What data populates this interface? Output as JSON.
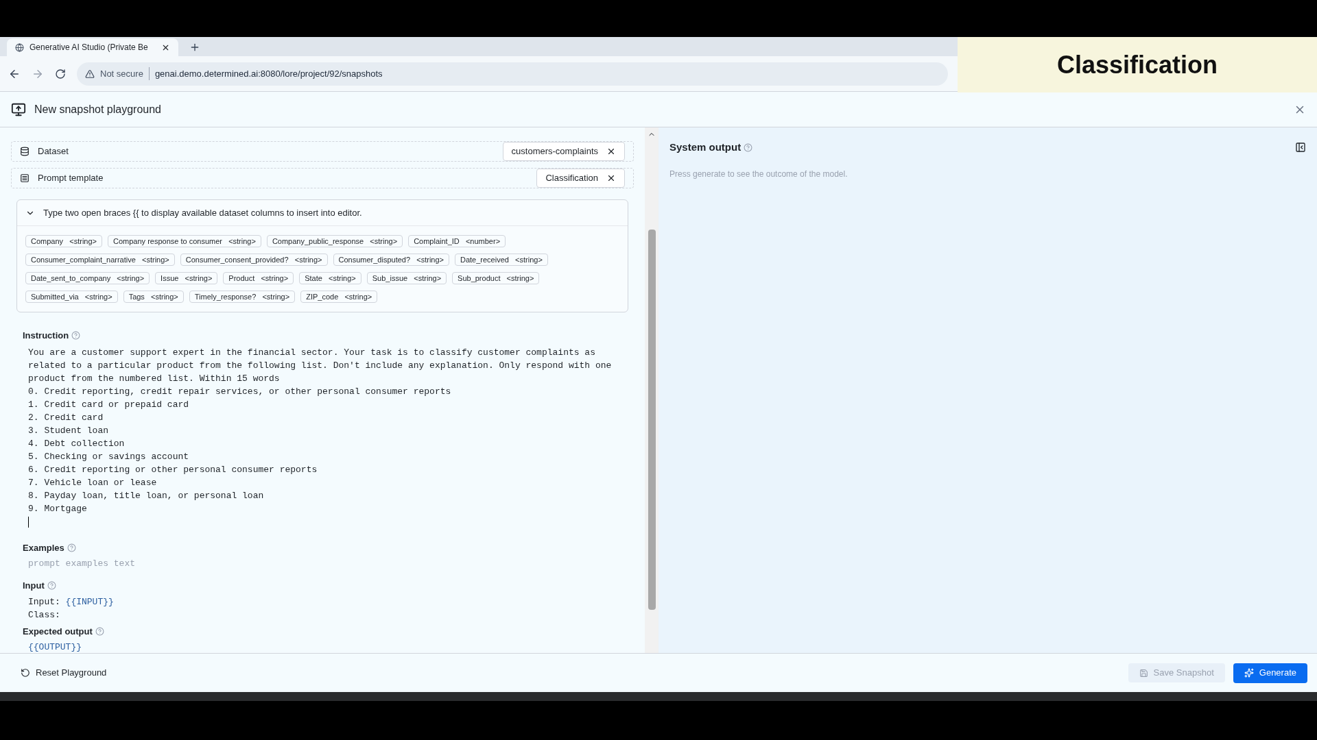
{
  "browser": {
    "tab_title": "Generative AI Studio (Private Be",
    "security_label": "Not secure",
    "url": "genai.demo.determined.ai:8080/lore/project/92/snapshots"
  },
  "caption": {
    "title": "Classification"
  },
  "header": {
    "title": "New snapshot playground"
  },
  "selectors": [
    {
      "kind": "dataset",
      "label": "Dataset",
      "value": "customers-complaints"
    },
    {
      "kind": "template",
      "label": "Prompt template",
      "value": "Classification"
    }
  ],
  "columns_panel": {
    "hint": "Type two open braces {{ to display available dataset columns to insert into editor.",
    "expanded": true,
    "columns": [
      {
        "name": "Company",
        "type": "<string>"
      },
      {
        "name": "Company response to consumer",
        "type": "<string>"
      },
      {
        "name": "Company_public_response",
        "type": "<string>"
      },
      {
        "name": "Complaint_ID",
        "type": "<number>"
      },
      {
        "name": "Consumer_complaint_narrative",
        "type": "<string>"
      },
      {
        "name": "Consumer_consent_provided?",
        "type": "<string>"
      },
      {
        "name": "Consumer_disputed?",
        "type": "<string>"
      },
      {
        "name": "Date_received",
        "type": "<string>"
      },
      {
        "name": "Date_sent_to_company",
        "type": "<string>"
      },
      {
        "name": "Issue",
        "type": "<string>"
      },
      {
        "name": "Product",
        "type": "<string>"
      },
      {
        "name": "State",
        "type": "<string>"
      },
      {
        "name": "Sub_issue",
        "type": "<string>"
      },
      {
        "name": "Sub_product",
        "type": "<string>"
      },
      {
        "name": "Submitted_via",
        "type": "<string>"
      },
      {
        "name": "Tags",
        "type": "<string>"
      },
      {
        "name": "Timely_response?",
        "type": "<string>"
      },
      {
        "name": "ZIP_code",
        "type": "<string>"
      }
    ]
  },
  "instruction": {
    "label": "Instruction",
    "text": "You are a customer support expert in the financial sector. Your task is to classify customer complaints as\nrelated to a particular product from the following list. Don't include any explanation. Only respond with one\nproduct from the numbered list. Within 15 words\n0. Credit reporting, credit repair services, or other personal consumer reports\n1. Credit card or prepaid card\n2. Credit card\n3. Student loan\n4. Debt collection\n5. Checking or savings account\n6. Credit reporting or other personal consumer reports\n7. Vehicle loan or lease\n8. Payday loan, title loan, or personal loan\n9. Mortgage"
  },
  "examples": {
    "label": "Examples",
    "placeholder": "prompt examples text"
  },
  "input": {
    "label": "Input",
    "lines": [
      [
        {
          "kind": "plain",
          "text": "Input: "
        },
        {
          "kind": "variable",
          "text": "{{INPUT}}"
        }
      ],
      [
        {
          "kind": "plain",
          "text": "Class:"
        }
      ]
    ]
  },
  "expected_output": {
    "label": "Expected output",
    "lines": [
      [
        {
          "kind": "variable",
          "text": "{{OUTPUT}}"
        }
      ]
    ]
  },
  "system_output": {
    "title": "System output",
    "placeholder": "Press generate to see the outcome of the model."
  },
  "footer": {
    "reset": "Reset Playground",
    "save": {
      "label": "Save Snapshot",
      "disabled": true
    },
    "generate": "Generate"
  }
}
